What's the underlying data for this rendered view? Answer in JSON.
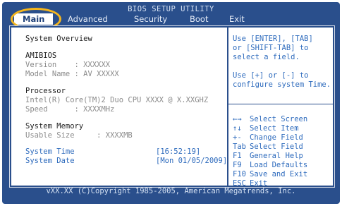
{
  "title": "BIOS SETUP UTILITY",
  "menu": {
    "main": "Main",
    "advanced": "Advanced",
    "security": "Security",
    "boot": "Boot",
    "exit": "Exit"
  },
  "main": {
    "section_title": "System Overview",
    "amibios": {
      "heading": "AMIBIOS",
      "version": "Version    : XXXXXX",
      "model_name": "Model Name : AV XXXXX"
    },
    "processor": {
      "heading": "Processor",
      "cpu": "Intel(R) Core(TM)2 Duo CPU XXXX @ X.XXGHZ",
      "speed": "Speed      : XXXXMHz"
    },
    "memory": {
      "heading": "System Memory",
      "usable_size": "Usable Size     : XXXXMB"
    },
    "system_time": {
      "label": "System Time",
      "value": "[16:52:19]"
    },
    "system_date": {
      "label": "System Date",
      "value": "[Mon 01/05/2009]"
    }
  },
  "help": {
    "lines": [
      "Use [ENTER], [TAB]",
      "or [SHIFT-TAB] to",
      "select a field.",
      "",
      "Use [+] or [-] to",
      "configure system Time."
    ],
    "keys": [
      {
        "key": "←→",
        "action": "Select Screen"
      },
      {
        "key": "↑↓",
        "action": "Select Item"
      },
      {
        "key": "+-",
        "action": "Change Field"
      },
      {
        "key": "Tab",
        "action": "Select Field"
      },
      {
        "key": "F1",
        "action": "General Help"
      },
      {
        "key": "F9",
        "action": "Load Defaults"
      },
      {
        "key": "F10",
        "action": "Save and Exit"
      },
      {
        "key": "ESC",
        "action": "Exit"
      }
    ]
  },
  "footer": "vXX.XX (C)Copyright 1985-2005, American Megatrends, Inc.",
  "colors": {
    "frame": "#2a4f8c",
    "highlight_ring": "#f5b61c",
    "help_text": "#2e6bbd",
    "dim_text": "#8b8b8b"
  }
}
